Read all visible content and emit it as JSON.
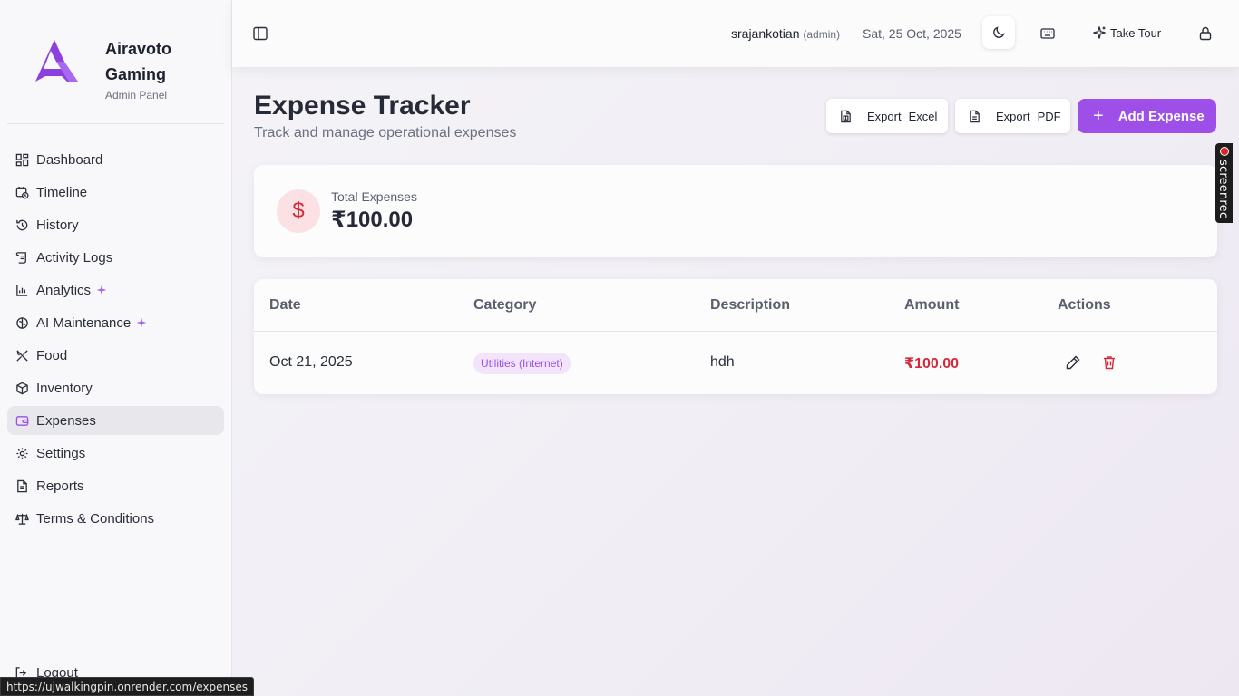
{
  "brand": {
    "name": "Airavoto Gaming",
    "subtitle": "Admin Panel",
    "accent": "#9d4fe8"
  },
  "sidebar": {
    "items": [
      {
        "label": "Dashboard",
        "icon": "dashboard-icon"
      },
      {
        "label": "Timeline",
        "icon": "calendar-clock-icon"
      },
      {
        "label": "History",
        "icon": "history-icon"
      },
      {
        "label": "Activity Logs",
        "icon": "scroll-icon"
      },
      {
        "label": "Analytics",
        "icon": "bar-chart-icon",
        "badge": "sparkles-icon"
      },
      {
        "label": "AI Maintenance",
        "icon": "brain-icon",
        "badge": "sparkles-icon"
      },
      {
        "label": "Food",
        "icon": "utensils-icon"
      },
      {
        "label": "Inventory",
        "icon": "package-icon"
      },
      {
        "label": "Expenses",
        "icon": "wallet-icon",
        "active": true
      },
      {
        "label": "Settings",
        "icon": "gear-icon"
      },
      {
        "label": "Reports",
        "icon": "file-text-icon"
      },
      {
        "label": "Terms & Conditions",
        "icon": "scale-icon"
      }
    ],
    "logout_label": "Logout"
  },
  "topbar": {
    "username": "srajankotian",
    "role": "(admin)",
    "date": "Sat, 25 Oct, 2025",
    "tour_label": "Take Tour"
  },
  "page": {
    "title": "Expense Tracker",
    "subtitle": "Track and manage operational expenses",
    "export_excel": {
      "a": "Export",
      "b": "Excel"
    },
    "export_pdf": {
      "a": "Export",
      "b": "PDF"
    },
    "add_label": "Add Expense"
  },
  "summary": {
    "label": "Total Expenses",
    "value": "₹100.00",
    "icon_glyph": "$"
  },
  "table": {
    "headers": [
      "Date",
      "Category",
      "Description",
      "Amount",
      "Actions"
    ],
    "rows": [
      {
        "date": "Oct 21, 2025",
        "category": "Utilities (Internet)",
        "description": "hdh",
        "amount": "₹100.00"
      }
    ]
  },
  "overlay": {
    "recorder_label": "screenrec"
  },
  "status_bar": {
    "url": "https://ujwalkingpin.onrender.com/expenses"
  },
  "colors": {
    "danger": "#d22a3a",
    "badge_bg": "#f1e4fb"
  }
}
